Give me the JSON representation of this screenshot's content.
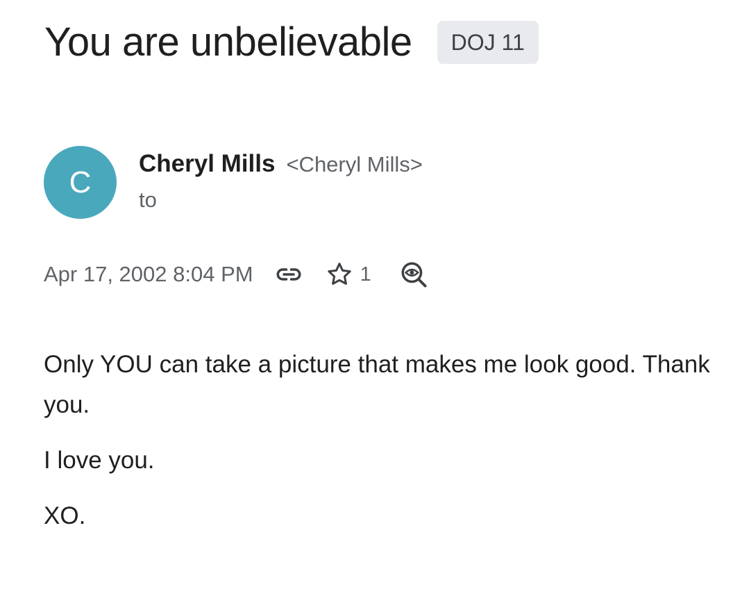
{
  "email": {
    "subject": "You are unbelievable",
    "label": "DOJ 11",
    "sender": {
      "avatar_letter": "C",
      "name": "Cheryl Mills",
      "email": "<Cheryl Mills>",
      "to_label": "to"
    },
    "meta": {
      "date": "Apr 17, 2002 8:04 PM",
      "star_count": "1",
      "icons": [
        "link-icon",
        "star-icon",
        "view-search-icon"
      ]
    },
    "body": {
      "line1": "Only YOU can take a picture that makes me look good. Thank you.",
      "line2": "I love you.",
      "line3": "XO."
    }
  },
  "colors": {
    "avatar": "#4aa8bd",
    "chip_bg": "#e8eaed",
    "secondary_text": "#5f6368",
    "primary_text": "#1f1f1f"
  }
}
